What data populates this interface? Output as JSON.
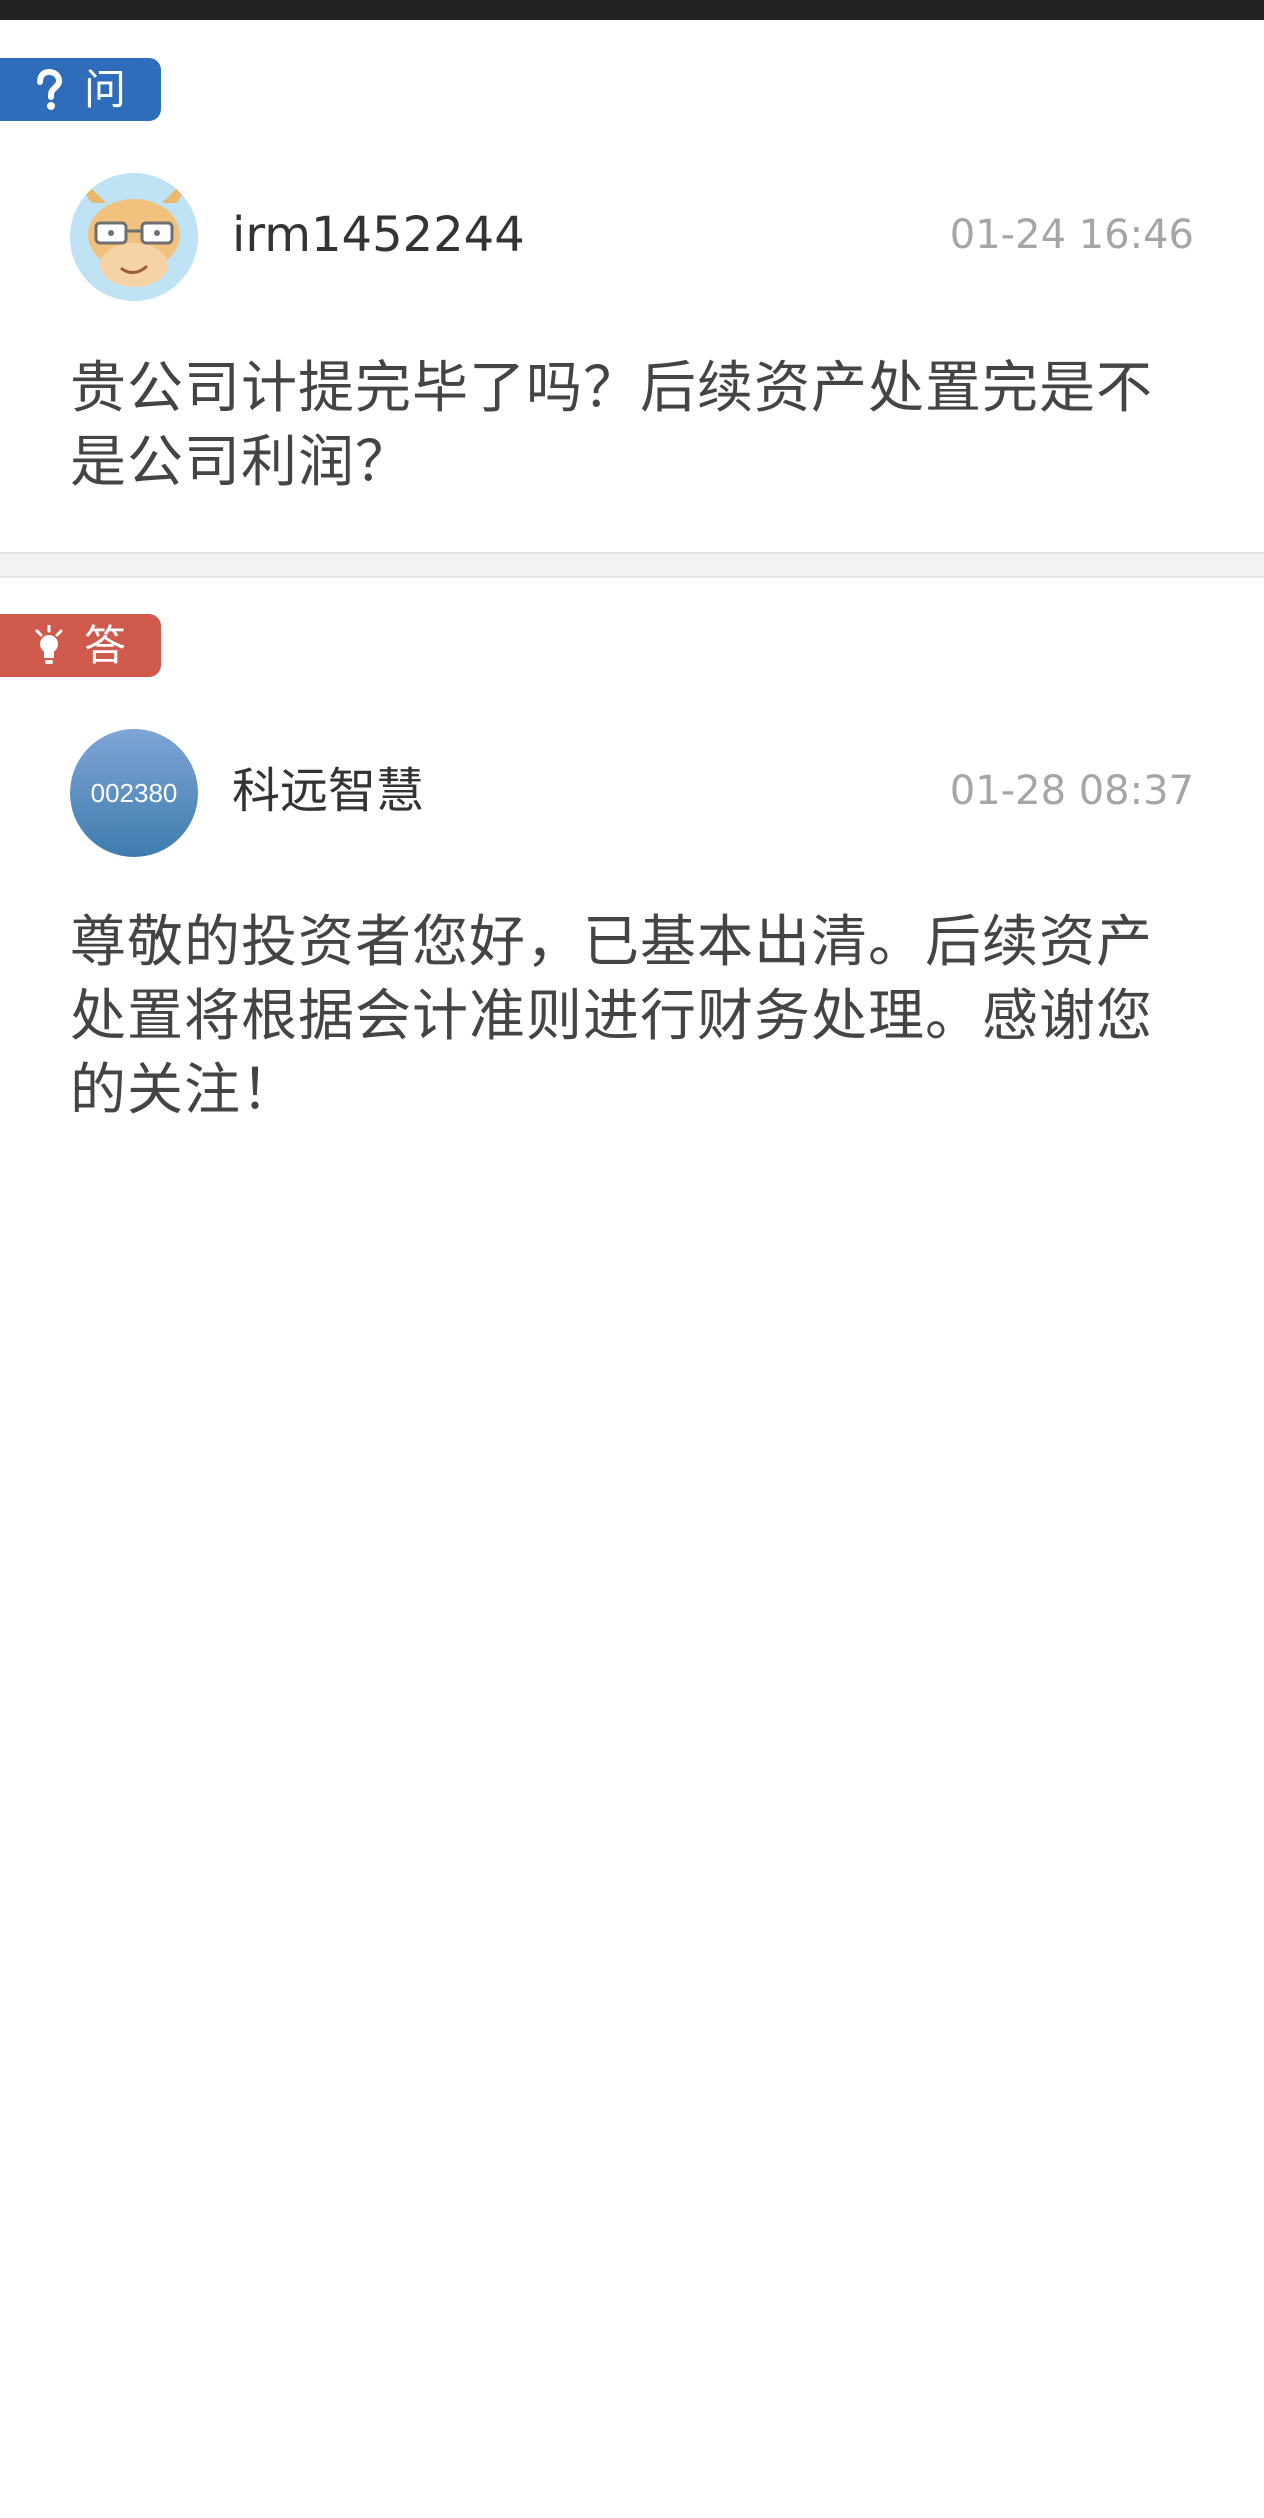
{
  "question": {
    "tag_label": "问",
    "tag_icon": "question-mark-icon",
    "tag_color": "#2f6cba",
    "username": "irm1452244",
    "avatar": "cartoon-cow-avatar",
    "timestamp": "01-24 16:46",
    "text": "贵公司计提完毕了吗？后续资产处置完是不是公司利润？"
  },
  "answer": {
    "tag_label": "答",
    "tag_icon": "lightbulb-icon",
    "tag_color": "#cf5a4b",
    "username": "科远智慧",
    "avatar_text": "002380",
    "timestamp": "01-28 08:37",
    "text": "尊敬的投资者您好，已基本出清。后续资产处置将根据会计准则进行财务处理。感谢您的关注！"
  }
}
